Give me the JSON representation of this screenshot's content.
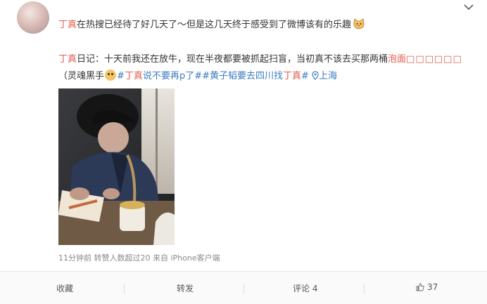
{
  "post": {
    "line1_prefix": "丁真",
    "line1_text": "在热搜已经待了好几天了～但是这几天终于感受到了微博该有的乐趣",
    "line2_name": "丁真",
    "line2_text": "日记：十天前我还在放牛，现在半夜都要被抓起扫盲，当初真不该去买那两桶",
    "line2_highlight": "泡面",
    "line2_tail": "□□□□□□",
    "line3_open": "（灵魂黑手",
    "tag1_prefix": "#",
    "tag1_name": "丁真",
    "tag1_rest": "说不要再p了#",
    "tag2_prefix": "#黄子韬要去四川找",
    "tag2_name": "丁真",
    "tag2_suffix": "#",
    "location": "上海",
    "meta": "11分钟前 转赞人数超过20   来自 iPhone客户端"
  },
  "actions": {
    "favorite": "收藏",
    "repost": "转发",
    "comment": "评论 4",
    "like": "37"
  },
  "colors": {
    "accent_red": "#e25b4c",
    "link_blue": "#3b7bbf"
  }
}
